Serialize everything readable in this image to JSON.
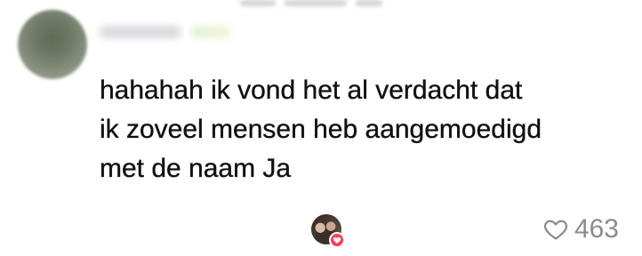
{
  "comment": {
    "text_lines": [
      "hahahah ik vond het al verdacht dat",
      "ik zoveel mensen heb aangemoedigd",
      "met de naam Ja"
    ],
    "like_count": "463",
    "icons": {
      "avatar": "user-avatar",
      "creator_like": "creator-liked-icon",
      "like": "heart-outline-icon"
    },
    "colors": {
      "text": "#111111",
      "like_count": "#8a8b91",
      "creator_heart": "#ff3b5c"
    }
  }
}
